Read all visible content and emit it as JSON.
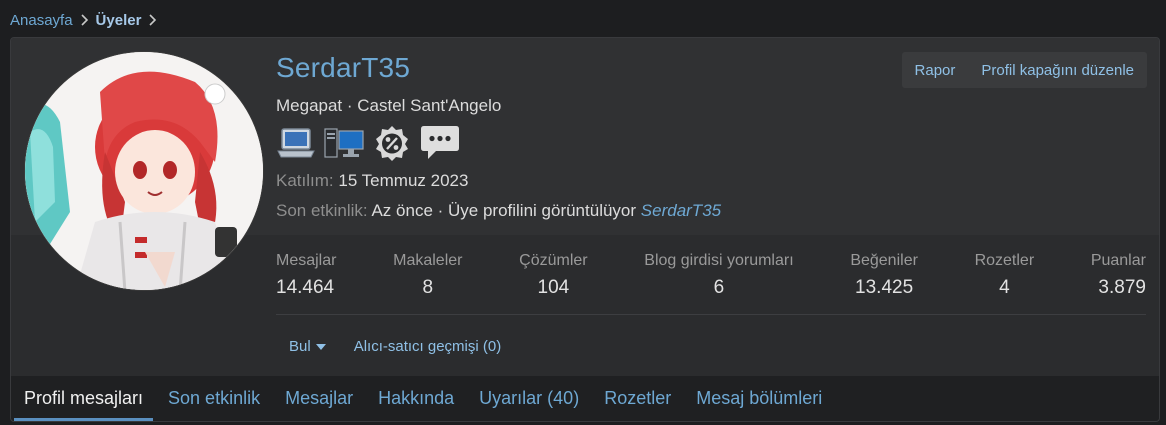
{
  "breadcrumb": {
    "home": "Anasayfa",
    "current": "Üyeler"
  },
  "profile": {
    "username": "SerdarT35",
    "title": "Megapat · Castel Sant'Angelo",
    "joined_label": "Katılım:",
    "joined_value": "15 Temmuz 2023",
    "activity_label": "Son etkinlik:",
    "activity_value": "Az önce · Üye profilini görüntülüyor",
    "activity_user": "SerdarT35",
    "badges": [
      "laptop-icon",
      "desktop-computer-icon",
      "percent-gear-icon",
      "speech-bubble-icon"
    ]
  },
  "actions": {
    "report": "Rapor",
    "edit_cover": "Profil kapağını düzenle"
  },
  "stats": [
    {
      "label": "Mesajlar",
      "value": "14.464"
    },
    {
      "label": "Makaleler",
      "value": "8"
    },
    {
      "label": "Çözümler",
      "value": "104"
    },
    {
      "label": "Blog girdisi yorumları",
      "value": "6"
    },
    {
      "label": "Beğeniler",
      "value": "13.425"
    },
    {
      "label": "Rozetler",
      "value": "4"
    },
    {
      "label": "Puanlar",
      "value": "3.879"
    }
  ],
  "sub_actions": {
    "find": "Bul",
    "trade_history": "Alıcı-satıcı geçmişi (0)"
  },
  "tabs": [
    {
      "label": "Profil mesajları",
      "active": true
    },
    {
      "label": "Son etkinlik"
    },
    {
      "label": "Mesajlar"
    },
    {
      "label": "Hakkında"
    },
    {
      "label": "Uyarılar (40)"
    },
    {
      "label": "Rozetler"
    },
    {
      "label": "Mesaj bölümleri"
    }
  ],
  "colors": {
    "accent": "#6ea8d3",
    "background": "#1d1e20",
    "card": "#2b2c2e"
  }
}
